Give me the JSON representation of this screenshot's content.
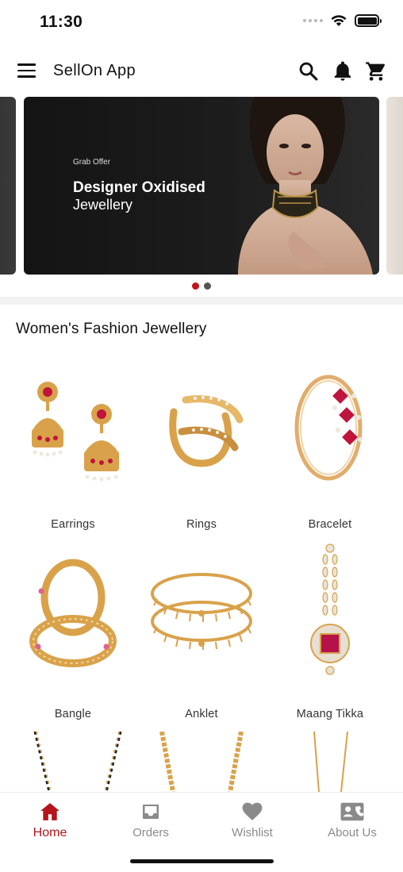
{
  "status_bar": {
    "time": "11:30"
  },
  "app_bar": {
    "title": "SellOn App",
    "icons": [
      "menu-icon",
      "search-icon",
      "bell-icon",
      "cart-icon"
    ]
  },
  "banner": {
    "eyebrow": "Grab Offer",
    "title": "Designer Oxidised",
    "subtitle": "Jewellery",
    "active_slide": 1,
    "dot_colors": [
      "#c0141b",
      "#555555"
    ]
  },
  "section": {
    "title": "Women's Fashion Jewellery"
  },
  "categories": [
    {
      "label": "Earrings",
      "icon": "earrings-image"
    },
    {
      "label": "Rings",
      "icon": "rings-image"
    },
    {
      "label": "Bracelet",
      "icon": "bracelet-image"
    },
    {
      "label": "Bangle",
      "icon": "bangle-image"
    },
    {
      "label": "Anklet",
      "icon": "anklet-image"
    },
    {
      "label": "Maang Tikka",
      "icon": "maang-tikka-image"
    },
    {
      "label": "",
      "icon": "mangalsutra-image"
    },
    {
      "label": "",
      "icon": "necklace-image"
    },
    {
      "label": "",
      "icon": "chain-image"
    }
  ],
  "bottom_nav": {
    "items": [
      {
        "label": "Home",
        "icon": "home-icon",
        "active": true
      },
      {
        "label": "Orders",
        "icon": "inbox-icon",
        "active": false
      },
      {
        "label": "Wishlist",
        "icon": "heart-icon",
        "active": false
      },
      {
        "label": "About Us",
        "icon": "contact-card-icon",
        "active": false
      }
    ]
  },
  "colors": {
    "accent": "#b3151b",
    "inactive": "#8a8a8a",
    "gold": "#d9a24a",
    "ruby": "#c0143c"
  }
}
